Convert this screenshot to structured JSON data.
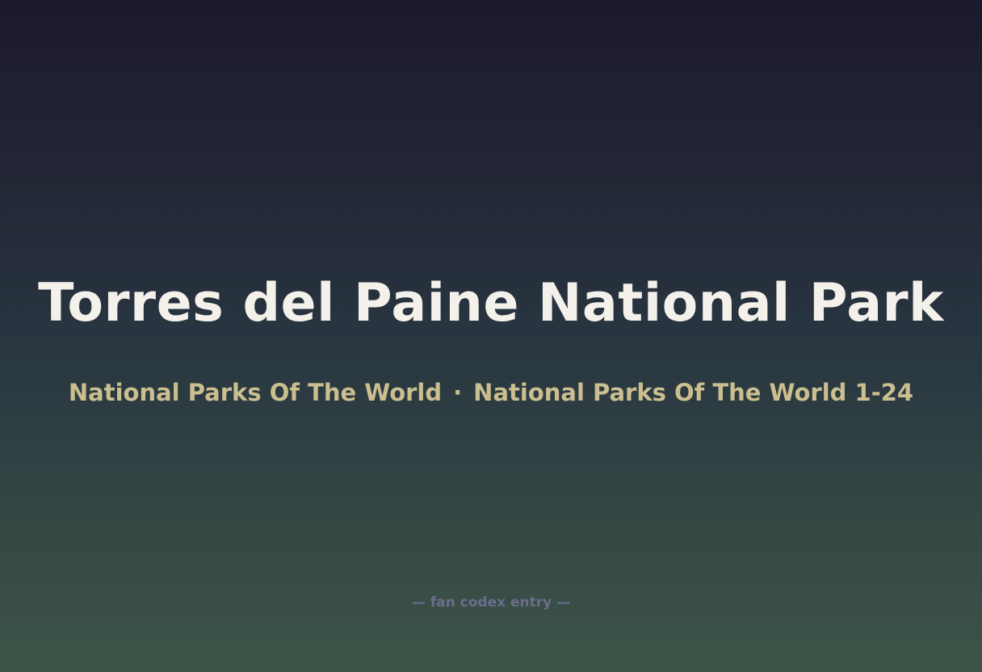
{
  "title": "Torres del Paine National Park",
  "subtitle": {
    "series": "National Parks Of The World",
    "separator": "·",
    "set": "National Parks Of The World 1-24"
  },
  "footer": "— fan codex entry —",
  "colors": {
    "title": "#f4f0ea",
    "subtitle": "#cbbe8f",
    "footer": "#6c6c8c",
    "background_top": "#1c1a2e",
    "background_bottom": "#3d5448"
  }
}
